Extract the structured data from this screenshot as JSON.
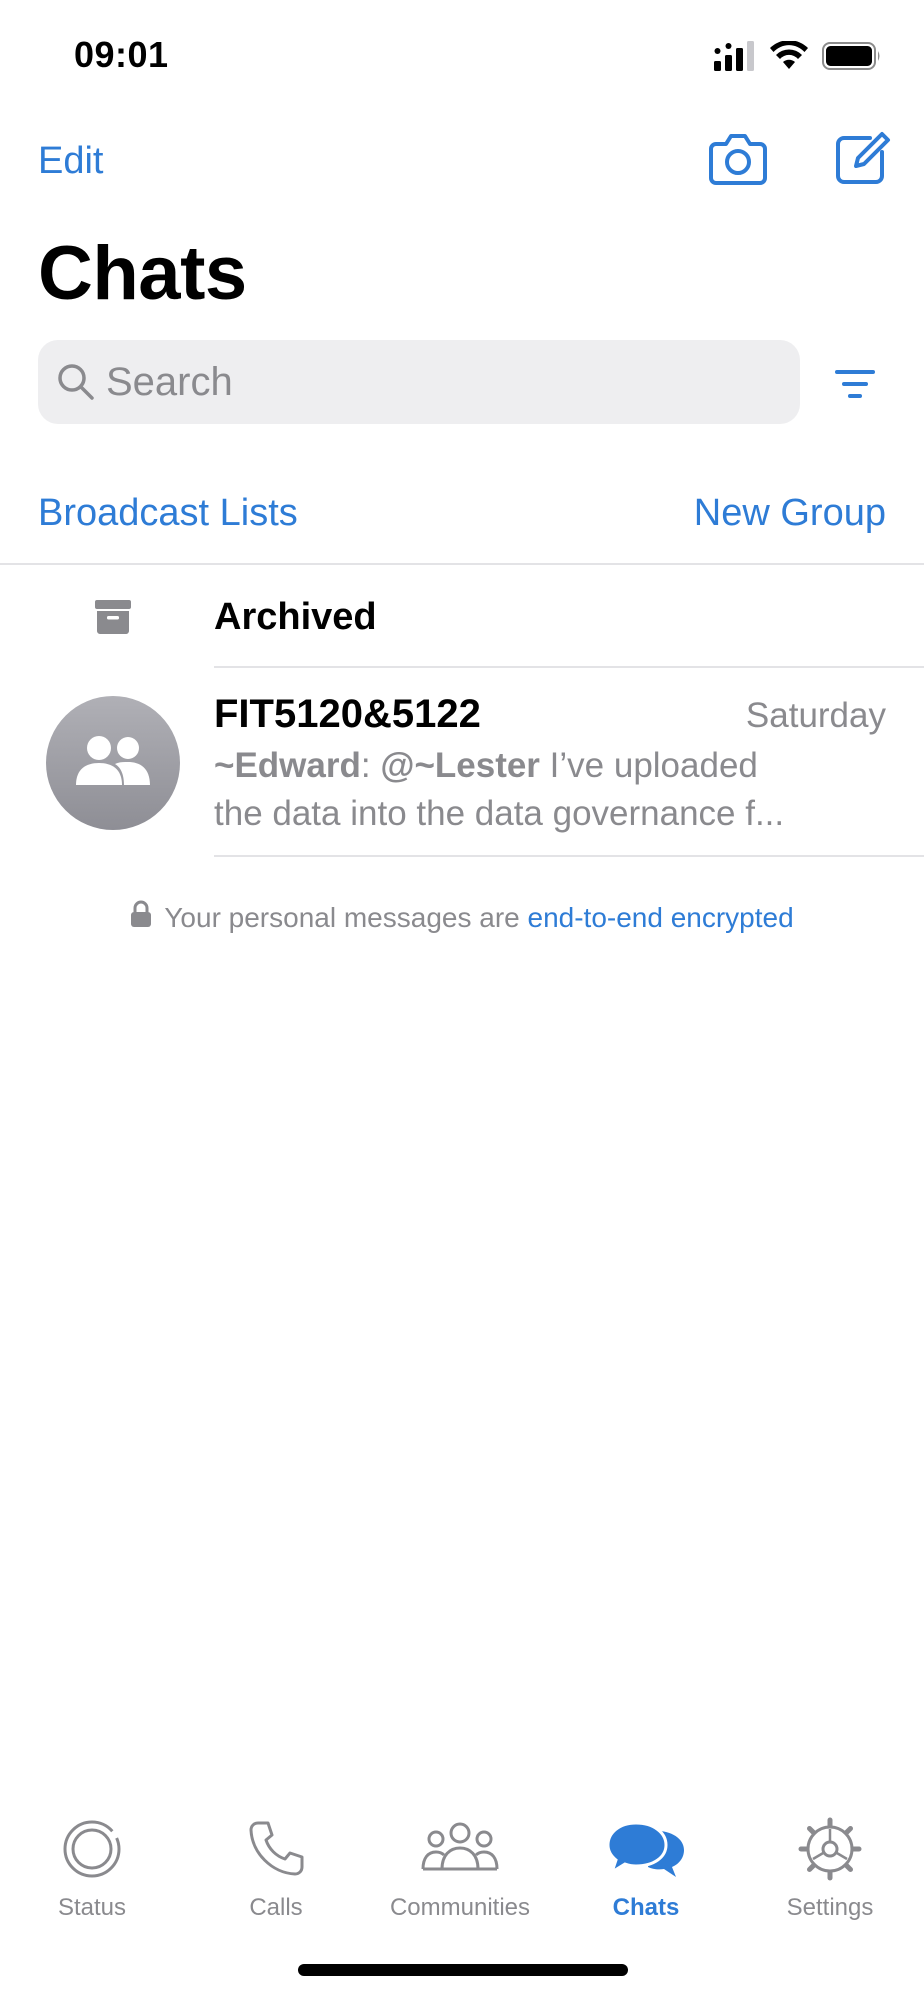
{
  "status_bar": {
    "time": "09:01"
  },
  "header": {
    "edit_label": "Edit",
    "camera_icon": "camera-icon",
    "compose_icon": "compose-icon",
    "title": "Chats"
  },
  "search": {
    "placeholder": "Search",
    "value": ""
  },
  "links": {
    "broadcast_lists": "Broadcast Lists",
    "new_group": "New Group"
  },
  "archived": {
    "label": "Archived"
  },
  "chats": [
    {
      "name": "FIT5120&5122",
      "time": "Saturday",
      "sender": "~Edward",
      "mention": "@~Lester",
      "preview_rest": " I’ve uploaded",
      "preview_line2": "the data into the data governance f..."
    }
  ],
  "encryption_note": {
    "text": "Your personal messages are",
    "link": "end-to-end encrypted"
  },
  "tab_bar": {
    "tabs": [
      {
        "label": "Status",
        "icon": "status-icon"
      },
      {
        "label": "Calls",
        "icon": "phone-icon"
      },
      {
        "label": "Communities",
        "icon": "communities-icon"
      },
      {
        "label": "Chats",
        "icon": "chats-icon"
      },
      {
        "label": "Settings",
        "icon": "gear-icon"
      }
    ],
    "active": "Chats"
  },
  "colors": {
    "accent": "#2e7cd6",
    "secondary_text": "#8a8a8e",
    "divider": "#e3e3e6"
  }
}
